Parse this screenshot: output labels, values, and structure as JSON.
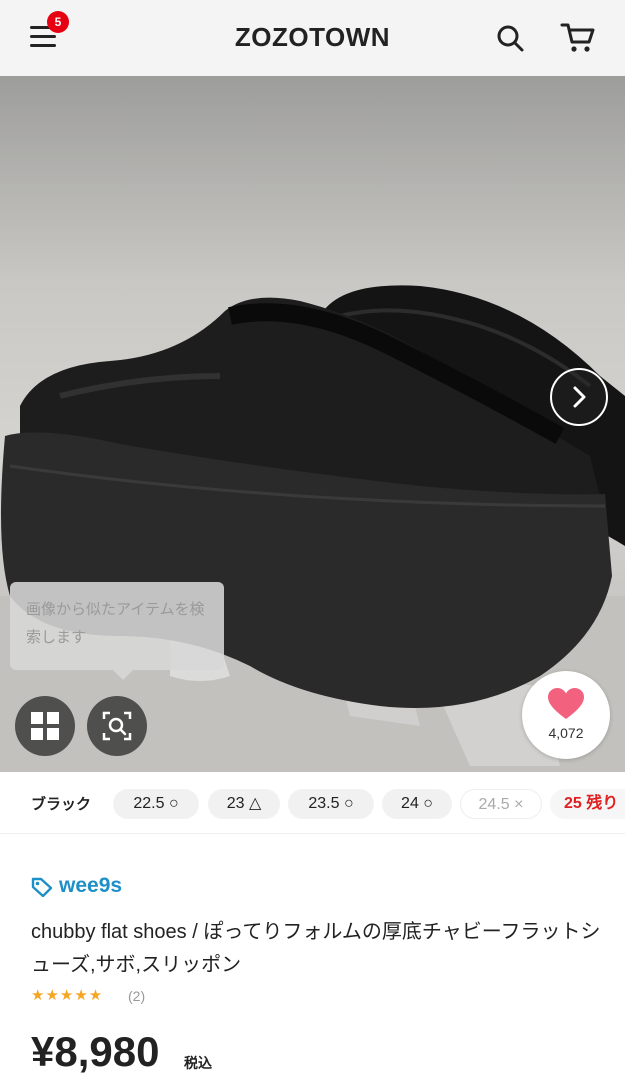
{
  "header": {
    "logo": "ZOZOTOWN",
    "notification_count": "5",
    "icons": {
      "menu": "menu-icon",
      "search": "search-icon",
      "cart": "cart-icon"
    }
  },
  "hero": {
    "tooltip": "画像から似たアイテムを検索します",
    "favorite_count": "4,072",
    "icons": {
      "next": "chevron-right-icon",
      "grid": "grid-icon",
      "lens": "image-search-icon",
      "favorite": "heart-icon"
    },
    "colors": {
      "heart": "#f2627f"
    }
  },
  "sizes": {
    "color_label": "ブラック",
    "options": [
      {
        "label": "22.5 ○",
        "available": true
      },
      {
        "label": "23 △",
        "available": true
      },
      {
        "label": "23.5 ○",
        "available": true
      },
      {
        "label": "24 ○",
        "available": true
      },
      {
        "label": "24.5 ×",
        "available": false
      },
      {
        "label": "25 残り",
        "available": true
      }
    ]
  },
  "product": {
    "brand": "wee9s",
    "title": "chubby flat shoes / ぽってりフォルムの厚底チャビーフラットシューズ,サボ,スリッポン",
    "stars": "★★★★★",
    "rating": 5,
    "review_count": "(2)",
    "price": "¥8,980",
    "tax_label": "税込",
    "colors": {
      "brand": "#1e90c8",
      "stars": "#f5a623",
      "low_stock": "#e02020"
    }
  }
}
